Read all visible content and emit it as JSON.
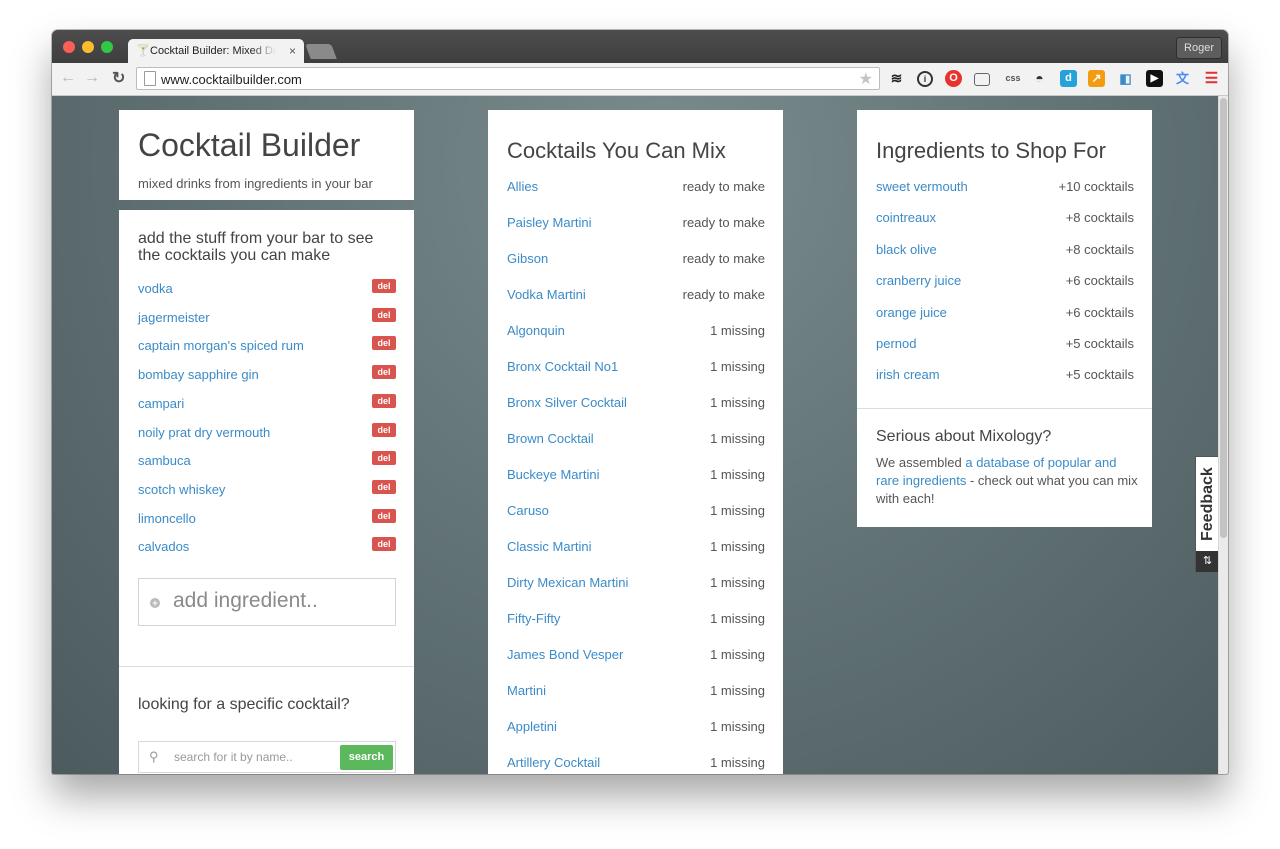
{
  "browser": {
    "tab_title": "Cocktail Builder: Mixed Drinks",
    "tab_close": "×",
    "profile": "Roger",
    "url": "www.cocktailbuilder.com",
    "extension_css_label": "css",
    "extension_d_label": "d"
  },
  "header": {
    "title": "Cocktail Builder",
    "subtitle": "mixed drinks from ingredients in your bar"
  },
  "bar": {
    "heading": "add the stuff from your bar to see the cocktails you can make",
    "del_label": "del",
    "ingredients": [
      "vodka",
      "jagermeister",
      "captain morgan's spiced rum",
      "bombay sapphire gin",
      "campari",
      "noily prat dry vermouth",
      "sambuca",
      "scotch whiskey",
      "limoncello",
      "calvados"
    ],
    "add_placeholder": "add ingredient.."
  },
  "search": {
    "heading": "looking for a specific cocktail?",
    "placeholder": "search for it by name..",
    "button": "search"
  },
  "mix": {
    "title": "Cocktails You Can Mix",
    "items": [
      {
        "name": "Allies",
        "status": "ready to make"
      },
      {
        "name": "Paisley Martini",
        "status": "ready to make"
      },
      {
        "name": "Gibson",
        "status": "ready to make"
      },
      {
        "name": "Vodka Martini",
        "status": "ready to make"
      },
      {
        "name": "Algonquin",
        "status": "1 missing"
      },
      {
        "name": "Bronx Cocktail No1",
        "status": "1 missing"
      },
      {
        "name": "Bronx Silver Cocktail",
        "status": "1 missing"
      },
      {
        "name": "Brown Cocktail",
        "status": "1 missing"
      },
      {
        "name": "Buckeye Martini",
        "status": "1 missing"
      },
      {
        "name": "Caruso",
        "status": "1 missing"
      },
      {
        "name": "Classic Martini",
        "status": "1 missing"
      },
      {
        "name": "Dirty Mexican Martini",
        "status": "1 missing"
      },
      {
        "name": "Fifty-Fifty",
        "status": "1 missing"
      },
      {
        "name": "James Bond Vesper",
        "status": "1 missing"
      },
      {
        "name": "Martini",
        "status": "1 missing"
      },
      {
        "name": "Appletini",
        "status": "1 missing"
      },
      {
        "name": "Artillery Cocktail",
        "status": "1 missing"
      }
    ]
  },
  "shop": {
    "title": "Ingredients to Shop For",
    "items": [
      {
        "name": "sweet vermouth",
        "count": "+10 cocktails"
      },
      {
        "name": "cointreaux",
        "count": "+8 cocktails"
      },
      {
        "name": "black olive",
        "count": "+8 cocktails"
      },
      {
        "name": "cranberry juice",
        "count": "+6 cocktails"
      },
      {
        "name": "orange juice",
        "count": "+6 cocktails"
      },
      {
        "name": "pernod",
        "count": "+5 cocktails"
      },
      {
        "name": "irish cream",
        "count": "+5 cocktails"
      }
    ]
  },
  "mixology": {
    "title": "Serious about Mixology?",
    "text_before": "We assembled ",
    "link": "a database of popular and rare ingredients",
    "text_after": " - check out what you can mix with each!"
  },
  "feedback": {
    "label": "Feedback",
    "icon_label": "⇅"
  },
  "colors": {
    "link": "#3a8bc8",
    "delete": "#d9534f",
    "search_button": "#5cb85c"
  }
}
